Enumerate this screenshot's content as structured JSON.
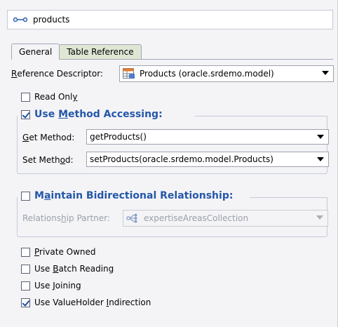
{
  "header": {
    "icon": "mapping-icon",
    "title": "products"
  },
  "tabs": [
    {
      "label": "General",
      "active": true
    },
    {
      "label": "Table Reference",
      "active": false
    }
  ],
  "reference_descriptor": {
    "label_prefix": "",
    "label_u": "R",
    "label_rest": "eference Descriptor:",
    "value": "Products (oracle.srdemo.model)",
    "icon": "table-descriptor-icon"
  },
  "read_only": {
    "pre": "Read Onl",
    "u": "y",
    "post": "",
    "checked": false
  },
  "method_group": {
    "checked": true,
    "title_pre": "Use ",
    "title_u": "M",
    "title_post": "ethod Accessing:",
    "get": {
      "pre": "",
      "u": "G",
      "post": "et Method:",
      "value": "getProducts()"
    },
    "set": {
      "pre": "Set Meth",
      "u": "o",
      "post": "d:",
      "value": "setProducts(oracle.srdemo.model.Products)"
    }
  },
  "bidirectional_group": {
    "checked": false,
    "title_pre": "M",
    "title_u": "a",
    "title_post": "intain Bidirectional Relationship:",
    "partner": {
      "pre": "Relations",
      "u": "h",
      "post": "ip Partner:",
      "value": "expertiseAreasCollection",
      "icon": "collection-mapping-icon"
    }
  },
  "options": [
    {
      "pre": "",
      "u": "P",
      "post": "rivate Owned",
      "checked": false
    },
    {
      "pre": "Use ",
      "u": "B",
      "post": "atch Reading",
      "checked": false
    },
    {
      "pre": "Use ",
      "u": "J",
      "post": "oining",
      "checked": false
    },
    {
      "pre": "Use ValueHolder ",
      "u": "I",
      "post": "ndirection",
      "checked": true
    }
  ]
}
